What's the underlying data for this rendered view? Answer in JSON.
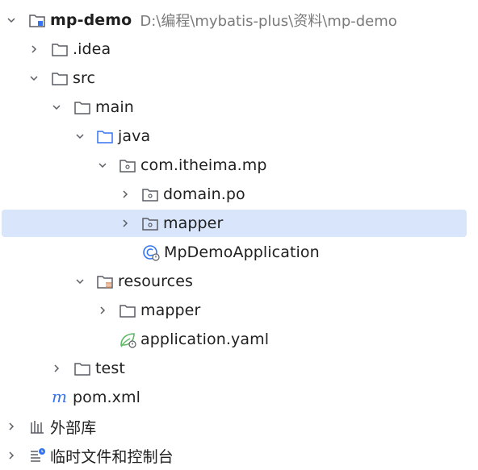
{
  "tree": {
    "root": {
      "label": "mp-demo",
      "path": "D:\\编程\\mybatis-plus\\资料\\mp-demo"
    },
    "idea": "idea",
    "src": "src",
    "main": "main",
    "java": "java",
    "package": "com.itheima.mp",
    "domain_po": "domain.po",
    "mapper_pkg": "mapper",
    "app_class": "MpDemoApplication",
    "resources": "resources",
    "mapper_res": "mapper",
    "application_yaml": "application.yaml",
    "test": "test",
    "pom": "pom.xml",
    "external_libs": "外部库",
    "scratches": "临时文件和控制台"
  },
  "colors": {
    "selection": "#d9e5fb",
    "folder_stroke": "#5a5d63",
    "source_folder": "#3574f0",
    "resources_accent": "#e08855",
    "spring_green": "#5fb865",
    "maven_blue": "#3574f0"
  }
}
